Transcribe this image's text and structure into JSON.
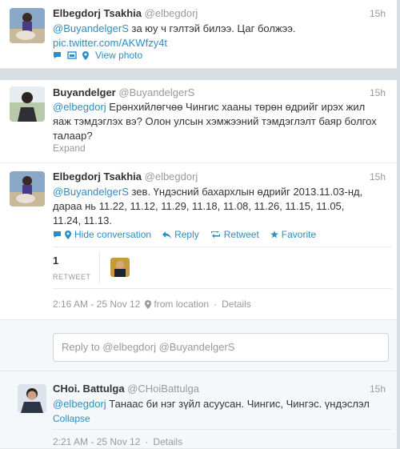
{
  "tweets": [
    {
      "name": "Elbegdorj Tsakhia",
      "handle": "@elbegdorj",
      "time": "15h",
      "mention": "@BuyandelgerS",
      "text": " за юу ч гэлтэй билээ. Цаг болжээ.",
      "pic_link": "pic.twitter.com/AKWfzy4t",
      "view_photo": "View photo"
    },
    {
      "name": "Buyandelger",
      "handle": "@BuyandelgerS",
      "time": "15h",
      "mention": "@elbegdorj",
      "text_line1": " Ерөнхийлөгчөө Чингис хааны төрөн өдрийг ирэх жил",
      "text_line2": "яаж тэмдэглэх вэ? Олон улсын хэмжээний тэмдэглэлт баяр болгох",
      "text_line3": "талаар?",
      "expand": "Expand"
    },
    {
      "name": "Elbegdorj Tsakhia",
      "handle": "@elbegdorj",
      "time": "15h",
      "mention": "@BuyandelgerS",
      "text_line1": " зев. Үндэсний бахархлын өдрийг 2013.11.03-нд,",
      "text_line2": "дараа нь 11.22, 11.12, 11.29, 11.18, 11.08, 11.26, 11.15, 11.05,",
      "text_line3": "11.24, 11.13.",
      "hide_conversation": "Hide conversation",
      "reply": "Reply",
      "retweet": "Retweet",
      "favorite": "Favorite",
      "retweet_count": "1",
      "retweet_label": "RETWEET",
      "timestamp": "2:16 AM - 25 Nov 12",
      "from_location": "from location",
      "details": "Details"
    }
  ],
  "reply_box": {
    "placeholder": "Reply to @elbegdorj @BuyandelgerS"
  },
  "reply_tweet": {
    "name": "CHoi. Battulga",
    "handle": "@CHoiBattulga",
    "time": "15h",
    "mention": "@elbegdorj",
    "text": " Танаас би нэг зүйл асуусан. Чингис, Чингэс. үндэслэл",
    "collapse": "Collapse",
    "timestamp": "2:21 AM - 25 Nov 12",
    "details": "Details"
  },
  "colors": {
    "link": "#2a8fc4",
    "muted": "#999999",
    "background": "#d8dee2"
  }
}
